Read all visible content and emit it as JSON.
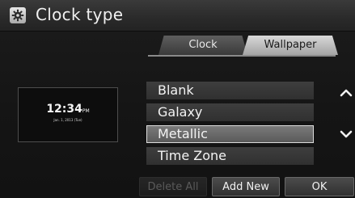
{
  "header": {
    "title": "Clock type",
    "icon": "gear-icon"
  },
  "tabs": [
    {
      "label": "Clock",
      "active": false
    },
    {
      "label": "Wallpaper",
      "active": true
    }
  ],
  "preview": {
    "time": "12:34",
    "ampm": "PM",
    "date": "Jan. 1, 2013 (Tue)"
  },
  "list": {
    "items": [
      {
        "label": "Blank",
        "selected": false
      },
      {
        "label": "Galaxy",
        "selected": false
      },
      {
        "label": "Metallic",
        "selected": true
      },
      {
        "label": "Time Zone",
        "selected": false
      }
    ],
    "scroll_up_icon": "chevron-up-icon",
    "scroll_down_icon": "chevron-down-icon"
  },
  "buttons": {
    "delete_all": "Delete All",
    "add_new": "Add New",
    "ok": "OK"
  },
  "colors": {
    "background": "#151515",
    "selected_item": "#6a6a6a",
    "active_tab": "#c4c4c4",
    "disabled_text": "#5a5a5a"
  }
}
